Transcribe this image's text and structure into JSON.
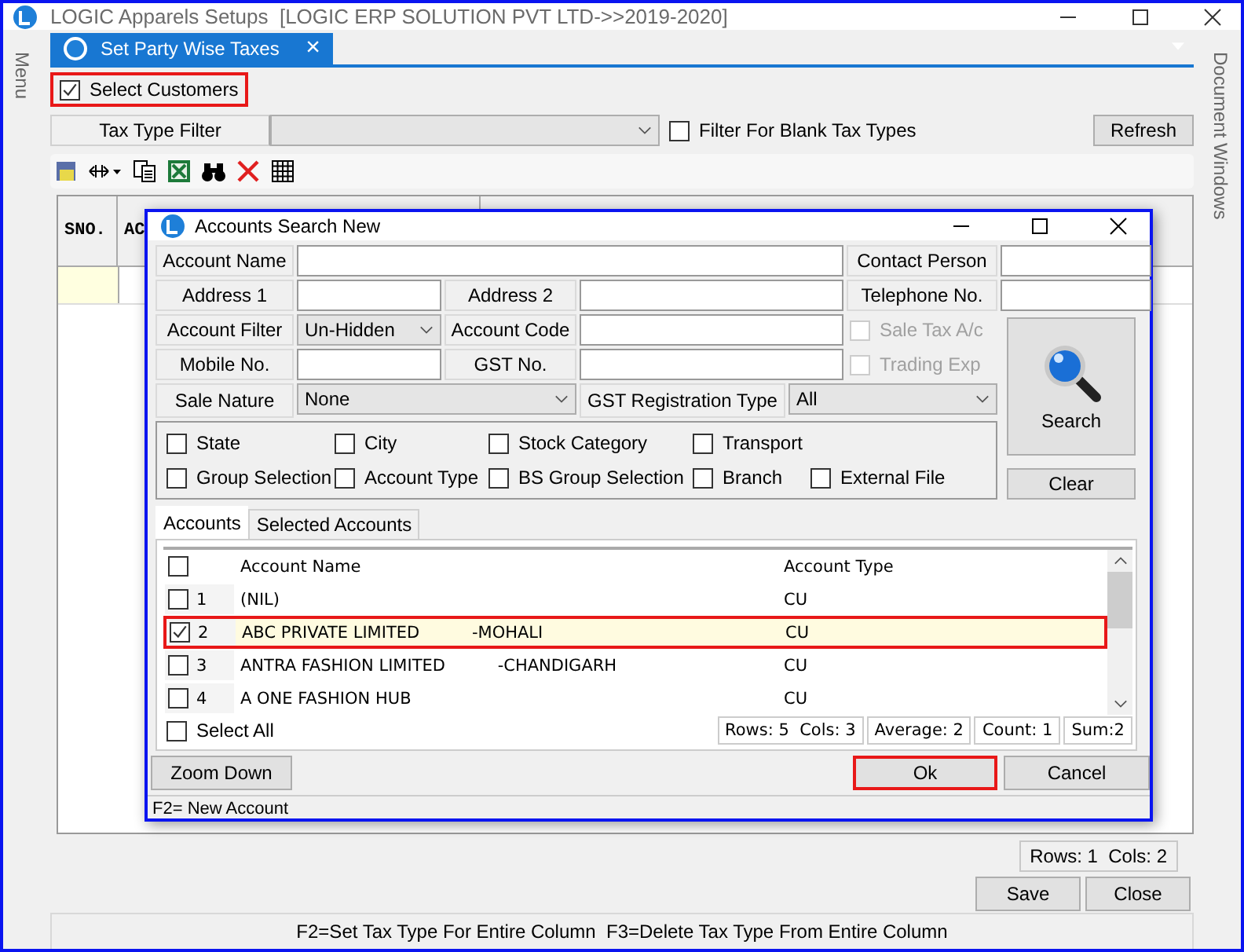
{
  "window": {
    "title": "LOGIC Apparels Setups  [LOGIC ERP SOLUTION PVT LTD->>2019-2020]"
  },
  "side_panels": {
    "left": "Menu",
    "right": "Document Windows"
  },
  "document_tab": {
    "label": "Set Party Wise Taxes",
    "close": "×",
    "selected": true
  },
  "select_customers": {
    "label": "Select Customers",
    "checked": true,
    "highlighted": true
  },
  "tax_type_filter": {
    "label": "Tax Type Filter"
  },
  "blank_tax_filter": {
    "label": "Filter For Blank Tax Types",
    "checked": false
  },
  "refresh_button": "Refresh",
  "grid": {
    "columns": [
      "SNO.",
      "AC"
    ],
    "footer": "Rows: 1  Cols: 2"
  },
  "buttons": [
    "Save",
    "Close"
  ],
  "hint": "F2=Set Tax Type For Entire Column  F3=Delete Tax Type From Entire Column",
  "dialog": {
    "title": "Accounts Search New",
    "fields": [
      {
        "label": "Account Name"
      },
      {
        "label": "Contact Person"
      },
      {
        "label": "Address 1"
      },
      {
        "label": "Address 2"
      },
      {
        "label": "Telephone No."
      },
      {
        "label": "Account Filter",
        "value": "Un-Hidden"
      },
      {
        "label": "Account Code"
      },
      {
        "label": "Mobile No."
      },
      {
        "label": "GST No."
      },
      {
        "label": "Sale Nature",
        "value": "None"
      },
      {
        "label": "GST Registration Type",
        "value": "All"
      }
    ],
    "options": [
      {
        "label": "Sale Tax A/c",
        "checked": false,
        "disabled": true
      },
      {
        "label": "Trading Exp",
        "checked": false,
        "disabled": true
      }
    ],
    "filters": [
      {
        "label": "State",
        "checked": false
      },
      {
        "label": "City",
        "checked": false
      },
      {
        "label": "Stock Category",
        "checked": false
      },
      {
        "label": "Transport",
        "checked": false
      },
      {
        "label": "Group Selection",
        "checked": false
      },
      {
        "label": "Account Type",
        "checked": false
      },
      {
        "label": "BS Group Selection",
        "checked": false
      },
      {
        "label": "Branch",
        "checked": false
      },
      {
        "label": "External File",
        "checked": false
      }
    ],
    "search_button": "Search",
    "clear_button": "Clear",
    "tabs": [
      {
        "label": "Accounts",
        "selected": true
      },
      {
        "label": "Selected Accounts",
        "selected": false
      }
    ],
    "list": {
      "columns": [
        "Account Name",
        "Account Type"
      ],
      "header_checked": false,
      "rows": [
        {
          "number": "1",
          "name": "(NIL)",
          "type": "CU",
          "checked": false,
          "highlighted": false
        },
        {
          "number": "2",
          "name": "ABC PRIVATE LIMITED          -MOHALI",
          "type": "CU",
          "checked": true,
          "highlighted": true
        },
        {
          "number": "3",
          "name": "ANTRA FASHION LIMITED          -CHANDIGARH",
          "type": "CU",
          "checked": false,
          "highlighted": false
        },
        {
          "number": "4",
          "name": "A ONE FASHION HUB",
          "type": "CU",
          "checked": false,
          "highlighted": false
        }
      ],
      "select_all": {
        "label": "Select All",
        "checked": false
      },
      "stats": [
        "Rows: 5  Cols: 3",
        "Average: 2",
        "Count: 1",
        "Sum:2"
      ]
    },
    "buttons": [
      {
        "label": "Zoom Down",
        "highlighted": false
      },
      {
        "label": "Ok",
        "highlighted": true
      },
      {
        "label": "Cancel",
        "highlighted": false
      }
    ],
    "status": "F2= New Account"
  }
}
